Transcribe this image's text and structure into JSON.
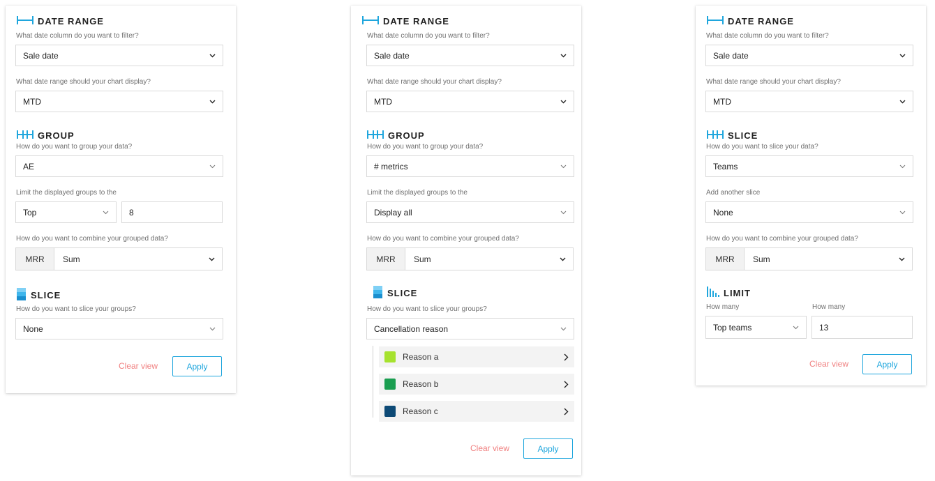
{
  "colors": {
    "accent": "#1fa6dd",
    "clear": "#f08080",
    "reason_a": "#a6e22e",
    "reason_b": "#1a9e50",
    "reason_c": "#0d4a76"
  },
  "panel1": {
    "date_title": "DATE RANGE",
    "date_col_q": "What date column do you want to filter?",
    "date_col_val": "Sale date",
    "date_range_q": "What date range should your chart display?",
    "date_range_val": "MTD",
    "group_title": "GROUP",
    "group_q": "How do you want to group your data?",
    "group_val": "AE",
    "limit_q": "Limit the displayed groups to the",
    "limit_dir": "Top",
    "limit_num": "8",
    "combine_q": "How do you want to combine your grouped data?",
    "combine_pre": "MRR",
    "combine_val": "Sum",
    "slice_title": "SLICE",
    "slice_q": "How do you want to slice your groups?",
    "slice_val": "None",
    "clear": "Clear view",
    "apply": "Apply"
  },
  "panel2": {
    "date_title": "DATE RANGE",
    "date_col_q": "What date column do you want to filter?",
    "date_col_val": "Sale date",
    "date_range_q": "What date range should your chart display?",
    "date_range_val": "MTD",
    "group_title": "GROUP",
    "group_q": "How do you want to group your data?",
    "group_val": "# metrics",
    "limit_q": "Limit the displayed groups to the",
    "limit_val": "Display all",
    "combine_q": "How do you want to combine your grouped data?",
    "combine_pre": "MRR",
    "combine_val": "Sum",
    "slice_title": "SLICE",
    "slice_q": "How do you want to slice your groups?",
    "slice_val": "Cancellation reason",
    "reasons": [
      "Reason a",
      "Reason b",
      "Reason c"
    ],
    "clear": "Clear view",
    "apply": "Apply"
  },
  "panel3": {
    "date_title": "DATE RANGE",
    "date_col_q": "What date column do you want to filter?",
    "date_col_val": "Sale date",
    "date_range_q": "What date range should your chart display?",
    "date_range_val": "MTD",
    "slice_title": "SLICE",
    "slice_q": "How do you want to slice your data?",
    "slice_val": "Teams",
    "another_q": "Add another slice",
    "another_val": "None",
    "combine_q": "How do you want to combine your grouped data?",
    "combine_pre": "MRR",
    "combine_val": "Sum",
    "limit_title": "LIMIT",
    "how_many_1": "How many",
    "how_many_2": "How many",
    "limit_dir": "Top teams",
    "limit_num": "13",
    "clear": "Clear view",
    "apply": "Apply"
  }
}
